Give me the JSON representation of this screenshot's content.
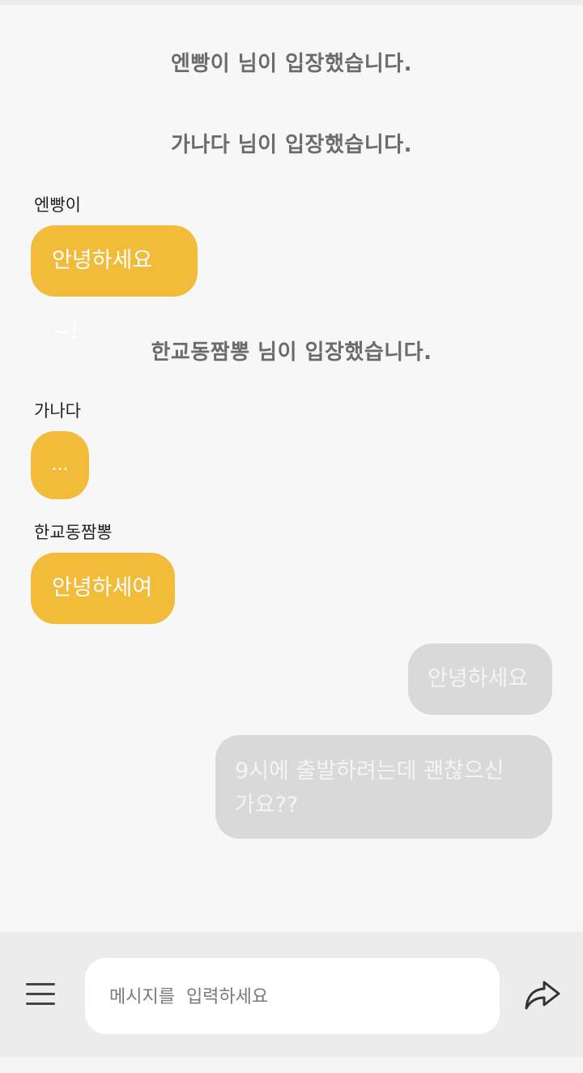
{
  "messages": {
    "system_1": "엔빵이 님이 입장했습니다.",
    "system_2": "가나다 님이 입장했습니다.",
    "sender_1": "엔빵이",
    "msg_1": "안녕하세요~!",
    "system_3": "한교동짬뽕 님이 입장했습니다.",
    "sender_2": "가나다",
    "msg_2": "...",
    "sender_3": "한교동짬뽕",
    "msg_3": "안녕하세여",
    "my_msg_1": "안녕하세요",
    "my_msg_2_line1": "9시에 출발하려는데 괜찮으신",
    "my_msg_2_line2": "가요??"
  },
  "composer": {
    "placeholder": "메시지를  입력하세요",
    "value": "",
    "menu_icon": "hamburger-menu-icon",
    "send_icon": "share-arrow-icon"
  },
  "colors": {
    "incoming_bubble": "#f2bb3a",
    "outgoing_bubble": "#d9d9d9",
    "background": "#f7f7f7",
    "system_text": "#6b6b6b"
  }
}
